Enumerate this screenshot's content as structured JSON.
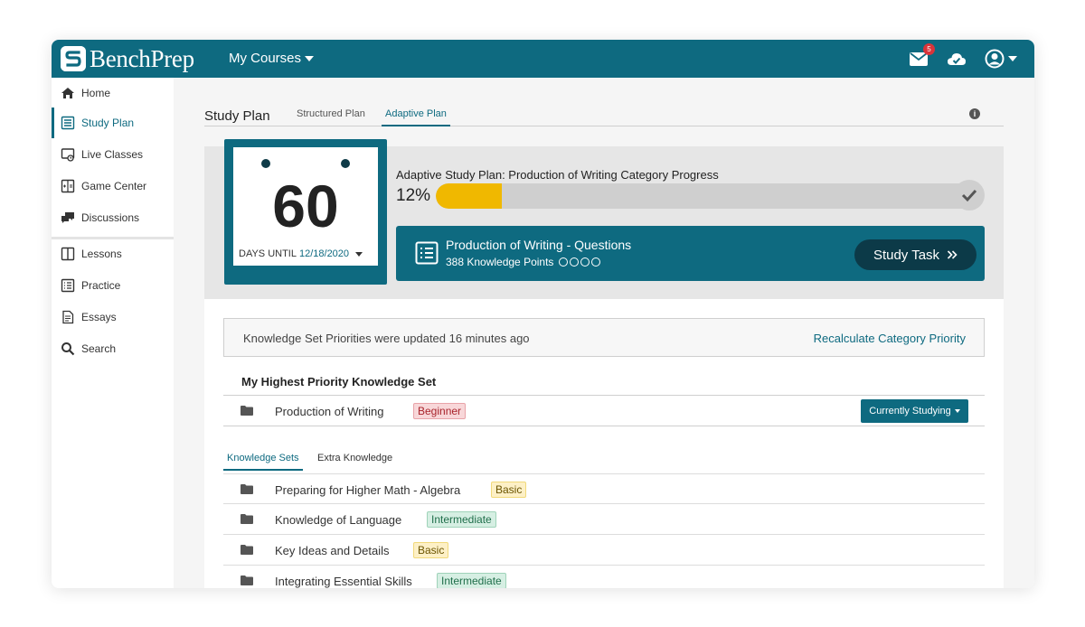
{
  "header": {
    "brand": "BenchPrep",
    "courses_label": "My Courses",
    "mail_badge": "5"
  },
  "sidebar": {
    "items": [
      {
        "label": "Home",
        "icon": "home-icon"
      },
      {
        "label": "Study Plan",
        "icon": "list-icon",
        "active": true
      },
      {
        "label": "Live Classes",
        "icon": "live-class-icon"
      },
      {
        "label": "Game Center",
        "icon": "game-icon"
      },
      {
        "label": "Discussions",
        "icon": "chat-icon"
      },
      {
        "label": "Lessons",
        "icon": "book-icon"
      },
      {
        "label": "Practice",
        "icon": "practice-icon"
      },
      {
        "label": "Essays",
        "icon": "essay-icon"
      },
      {
        "label": "Search",
        "icon": "search-icon"
      }
    ]
  },
  "study_plan": {
    "title": "Study Plan",
    "tabs": [
      {
        "label": "Structured Plan"
      },
      {
        "label": "Adaptive Plan",
        "active": true
      }
    ]
  },
  "countdown": {
    "days": "60",
    "until_label": "DAYS UNTIL",
    "date": "12/18/2020"
  },
  "progress": {
    "label": "Adaptive Study Plan: Production of Writing Category Progress",
    "percent_text": "12%",
    "percent": 12,
    "fill_color": "#f0b800"
  },
  "task": {
    "title": "Production of Writing - Questions",
    "subtitle": "388 Knowledge Points",
    "button_label": "Study Task"
  },
  "notice": {
    "text": "Knowledge Set Priorities were updated 16 minutes ago",
    "link": "Recalculate Category Priority"
  },
  "highest_priority": {
    "title": "My Highest Priority Knowledge Set",
    "name": "Production of Writing",
    "level": "Beginner",
    "button_label": "Currently Studying"
  },
  "knowledge_tabs": [
    {
      "label": "Knowledge Sets",
      "active": true
    },
    {
      "label": "Extra Knowledge"
    }
  ],
  "knowledge_sets": [
    {
      "name": "Preparing for Higher Math - Algebra",
      "level": "Basic"
    },
    {
      "name": "Knowledge of Language",
      "level": "Intermediate"
    },
    {
      "name": "Key Ideas and Details",
      "level": "Basic"
    },
    {
      "name": "Integrating Essential Skills",
      "level": "Intermediate"
    }
  ],
  "colors": {
    "brand": "#0e6a80",
    "brand_dark": "#0c3a48",
    "beginner": "#f8d7d9",
    "basic": "#fdf0c6",
    "intermediate": "#d6efe3"
  }
}
